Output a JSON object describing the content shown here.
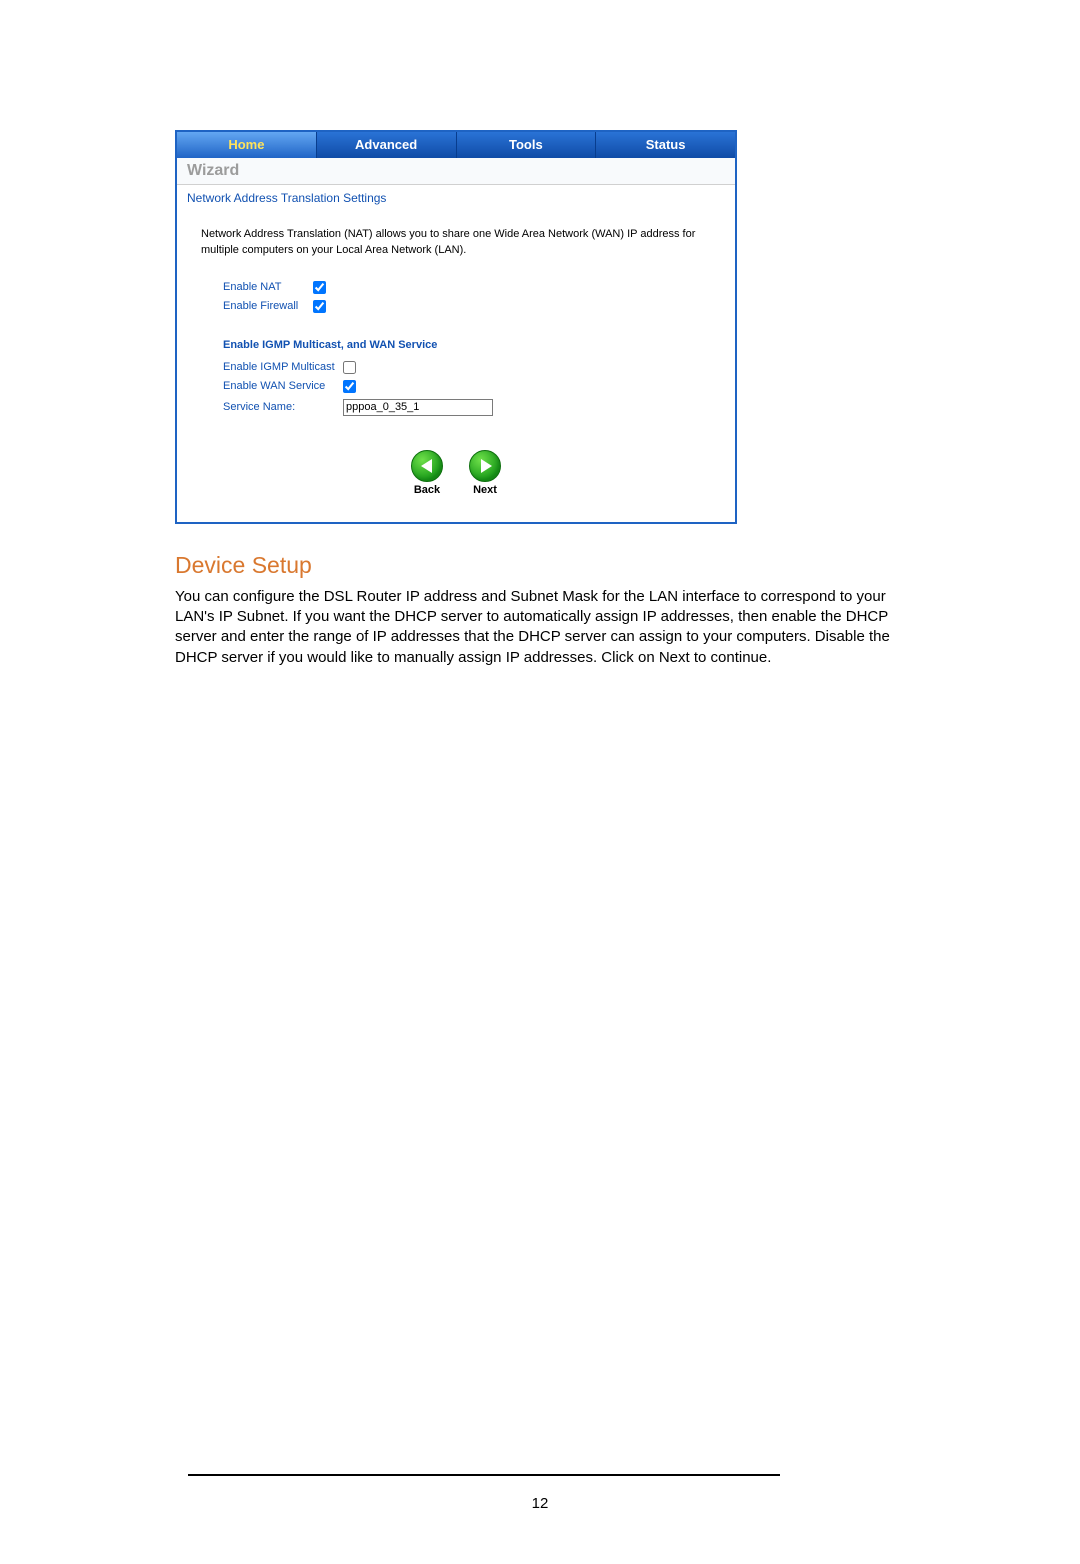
{
  "tabs": {
    "home": "Home",
    "advanced": "Advanced",
    "tools": "Tools",
    "status": "Status"
  },
  "wizard_label": "Wizard",
  "section_title": "Network Address Translation Settings",
  "description": "Network Address Translation (NAT) allows you to share one Wide Area Network (WAN) IP address for multiple computers on your Local Area Network (LAN).",
  "fields": {
    "enable_nat": {
      "label": "Enable NAT",
      "checked": true
    },
    "enable_firewall": {
      "label": "Enable Firewall",
      "checked": true
    },
    "igmp_heading": "Enable IGMP Multicast, and WAN Service",
    "enable_igmp": {
      "label": "Enable IGMP Multicast",
      "checked": false
    },
    "enable_wan": {
      "label": "Enable WAN Service",
      "checked": true
    },
    "service_name": {
      "label": "Service Name:",
      "value": "pppoa_0_35_1"
    }
  },
  "nav": {
    "back": "Back",
    "next": "Next"
  },
  "doc": {
    "heading": "Device Setup",
    "paragraph": "You can configure the DSL Router IP address and Subnet Mask for the LAN interface to correspond to your LAN's IP Subnet. If you want the DHCP server to automatically assign IP addresses, then enable the DHCP server and enter the range of IP addresses that the DHCP server can assign to your computers.  Disable the DHCP server if you would like to manually assign IP addresses.  Click on Next to continue."
  },
  "page_number": "12"
}
